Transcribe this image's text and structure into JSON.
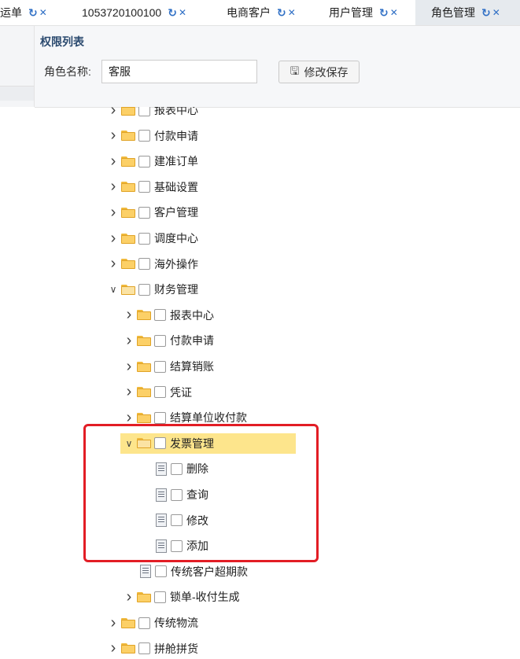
{
  "tabs": [
    {
      "label": "运单",
      "active": false
    },
    {
      "label": "1053720100100",
      "active": false
    },
    {
      "label": "电商客户",
      "active": false
    },
    {
      "label": "用户管理",
      "active": false
    },
    {
      "label": "角色管理",
      "active": true
    }
  ],
  "panel": {
    "title": "权限列表",
    "role_label": "角色名称:",
    "role_value": "客服",
    "save_label": "修改保存"
  },
  "tree": [
    {
      "label": "报表中心",
      "level": 0,
      "type": "folder",
      "expanded": false
    },
    {
      "label": "付款申请",
      "level": 0,
      "type": "folder",
      "expanded": false
    },
    {
      "label": "建准订单",
      "level": 0,
      "type": "folder",
      "expanded": false
    },
    {
      "label": "基础设置",
      "level": 0,
      "type": "folder",
      "expanded": false
    },
    {
      "label": "客户管理",
      "level": 0,
      "type": "folder",
      "expanded": false
    },
    {
      "label": "调度中心",
      "level": 0,
      "type": "folder",
      "expanded": false
    },
    {
      "label": "海外操作",
      "level": 0,
      "type": "folder",
      "expanded": false
    },
    {
      "label": "财务管理",
      "level": 0,
      "type": "folder",
      "expanded": true
    },
    {
      "label": "报表中心",
      "level": 1,
      "type": "folder",
      "expanded": false
    },
    {
      "label": "付款申请",
      "level": 1,
      "type": "folder",
      "expanded": false
    },
    {
      "label": "结算销账",
      "level": 1,
      "type": "folder",
      "expanded": false
    },
    {
      "label": "凭证",
      "level": 1,
      "type": "folder",
      "expanded": false
    },
    {
      "label": "结算单位收付款",
      "level": 1,
      "type": "folder",
      "expanded": false
    },
    {
      "label": "发票管理",
      "level": 1,
      "type": "folder",
      "expanded": true,
      "selected": true
    },
    {
      "label": "删除",
      "level": 2,
      "type": "leaf"
    },
    {
      "label": "查询",
      "level": 2,
      "type": "leaf"
    },
    {
      "label": "修改",
      "level": 2,
      "type": "leaf"
    },
    {
      "label": "添加",
      "level": 2,
      "type": "leaf"
    },
    {
      "label": "传统客户超期款",
      "level": 1,
      "type": "leaf"
    },
    {
      "label": "锁单-收付生成",
      "level": 1,
      "type": "folder",
      "expanded": false
    },
    {
      "label": "传统物流",
      "level": 0,
      "type": "folder",
      "expanded": false
    },
    {
      "label": "拼舱拼货",
      "level": 0,
      "type": "folder",
      "expanded": false
    }
  ],
  "icons": {
    "tab_refresh": "refresh-icon",
    "tab_close": "close-icon",
    "save": "floppy-disk-icon",
    "collapsed": "chevron-right-icon",
    "expanded": "chevron-down-icon",
    "folder": "folder-icon",
    "leaf": "document-icon"
  },
  "colors": {
    "accent": "#2f6fc5",
    "selected_row": "#fde58c",
    "highlight_box": "#e21d25"
  }
}
